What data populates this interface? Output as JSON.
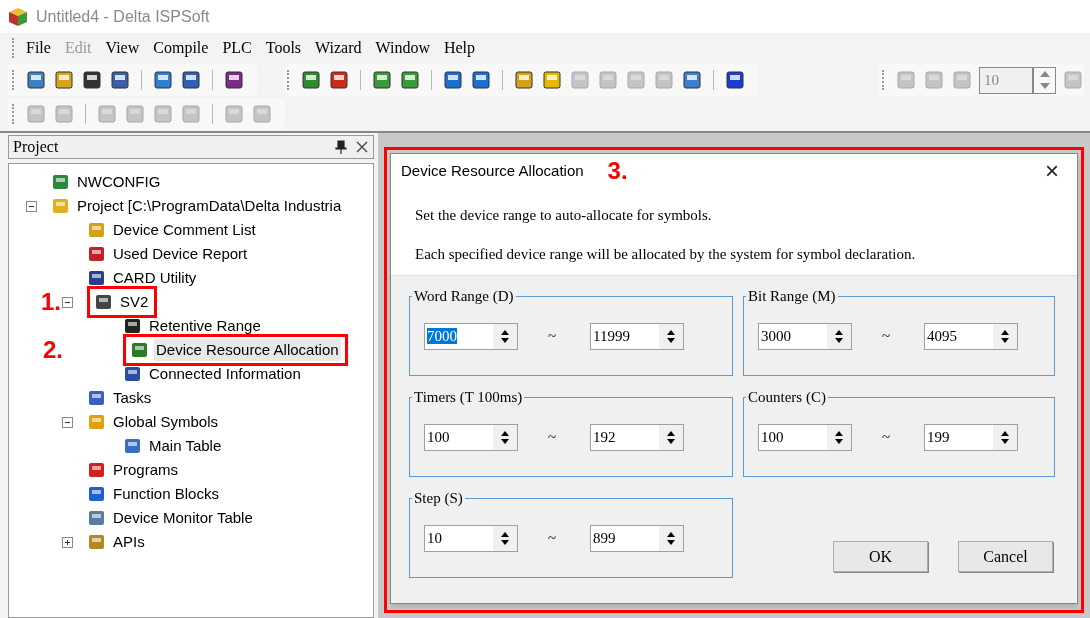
{
  "window": {
    "title": "Untitled4 - Delta ISPSoft"
  },
  "menu": [
    {
      "label": "File",
      "disabled": false
    },
    {
      "label": "Edit",
      "disabled": true
    },
    {
      "label": "View",
      "disabled": false
    },
    {
      "label": "Compile",
      "disabled": false
    },
    {
      "label": "PLC",
      "disabled": false
    },
    {
      "label": "Tools",
      "disabled": false
    },
    {
      "label": "Wizard",
      "disabled": false
    },
    {
      "label": "Window",
      "disabled": false
    },
    {
      "label": "Help",
      "disabled": false
    }
  ],
  "toolbar": {
    "scan_field": {
      "value": "10",
      "disabled": true
    }
  },
  "project_panel": {
    "title": "Project",
    "tree": [
      {
        "label": "NWCONFIG",
        "selected": false
      },
      {
        "label": "Project [C:\\ProgramData\\Delta Industria",
        "expanded": true,
        "selected": false,
        "children": [
          {
            "label": "Device Comment List",
            "selected": false
          },
          {
            "label": "Used Device Report",
            "selected": false
          },
          {
            "label": "CARD Utility",
            "selected": false
          },
          {
            "label": "SV2",
            "expanded": true,
            "selected": false,
            "annotation": "1.",
            "children": [
              {
                "label": "Retentive Range",
                "selected": false
              },
              {
                "label": "Device Resource Allocation",
                "selected": true,
                "annotation": "2."
              },
              {
                "label": "Connected Information",
                "selected": false
              }
            ]
          },
          {
            "label": "Tasks",
            "selected": false
          },
          {
            "label": "Global Symbols",
            "expanded": true,
            "selected": false,
            "children": [
              {
                "label": "Main Table",
                "selected": false
              }
            ]
          },
          {
            "label": "Programs",
            "selected": false
          },
          {
            "label": "Function Blocks",
            "selected": false
          },
          {
            "label": "Device Monitor Table",
            "selected": false
          },
          {
            "label": "APIs",
            "expanded": false,
            "selected": false
          }
        ]
      }
    ]
  },
  "dialog": {
    "title": "Device Resource Allocation",
    "annotation": "3.",
    "close": "×",
    "description": [
      "Set the device range to auto-allocate for symbols.",
      "Each specified device range will be allocated by the system for symbol declaration."
    ],
    "groups": [
      {
        "title": "Word Range (D)",
        "from": {
          "value": "7000",
          "selected": true
        },
        "separator": "~",
        "to": {
          "value": "11999",
          "selected": false
        }
      },
      {
        "title": "Bit Range (M)",
        "from": {
          "value": "3000",
          "selected": false
        },
        "separator": "~",
        "to": {
          "value": "4095",
          "selected": false
        }
      },
      {
        "title": "Timers (T 100ms)",
        "from": {
          "value": "100",
          "selected": false
        },
        "separator": "~",
        "to": {
          "value": "192",
          "selected": false
        }
      },
      {
        "title": "Counters (C)",
        "from": {
          "value": "100",
          "selected": false
        },
        "separator": "~",
        "to": {
          "value": "199",
          "selected": false
        }
      },
      {
        "title": "Step (S)",
        "from": {
          "value": "10",
          "selected": false
        },
        "separator": "~",
        "to": {
          "value": "899",
          "selected": false
        }
      }
    ],
    "buttons": [
      "OK",
      "Cancel"
    ]
  }
}
